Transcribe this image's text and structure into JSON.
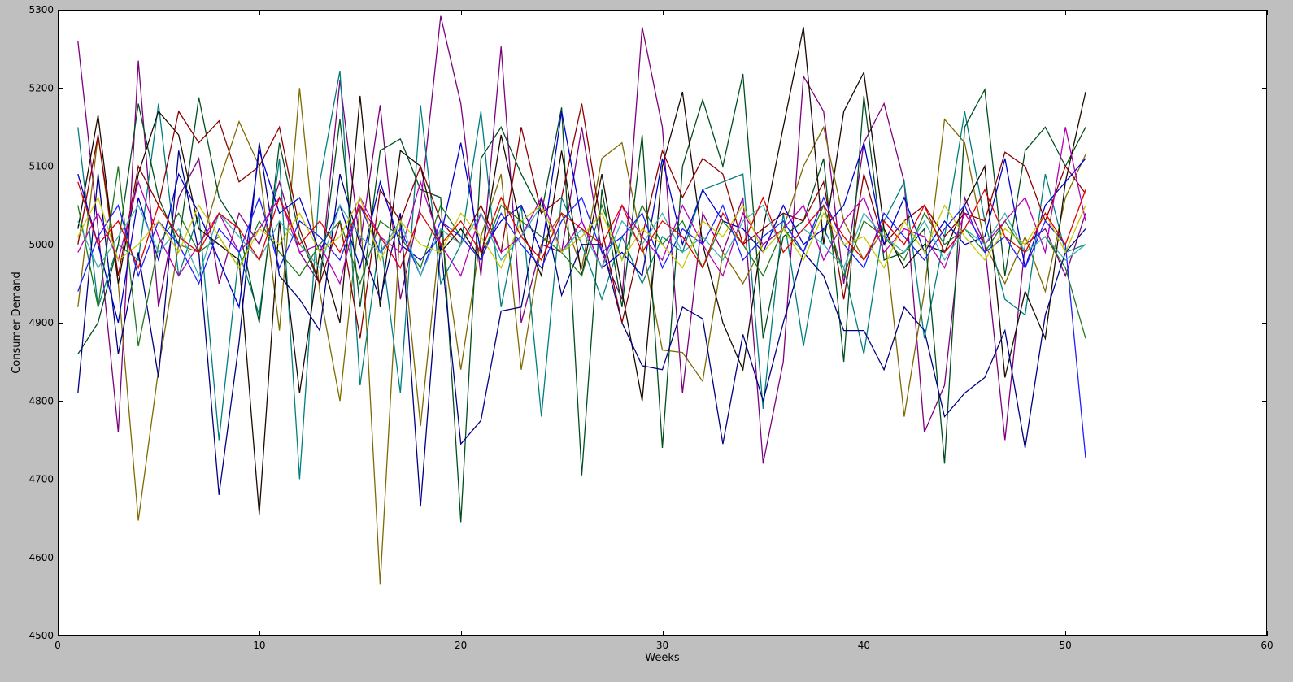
{
  "colors": {
    "background": "#bfbfbf",
    "plot_area": "#ffffff",
    "axes": "#000000"
  },
  "chart_data": {
    "type": "line",
    "title": "",
    "xlabel": "Weeks",
    "ylabel": "Consumer Demand",
    "xlim": [
      0,
      60
    ],
    "ylim": [
      4500,
      5300
    ],
    "xticks": [
      0,
      10,
      20,
      30,
      40,
      50,
      60
    ],
    "yticks": [
      4500,
      4600,
      4700,
      4800,
      4900,
      5000,
      5100,
      5200,
      5300
    ],
    "grid": false,
    "legend": "none",
    "x": [
      1,
      2,
      3,
      4,
      5,
      6,
      7,
      8,
      9,
      10,
      11,
      12,
      13,
      14,
      15,
      16,
      17,
      18,
      19,
      20,
      21,
      22,
      23,
      24,
      25,
      26,
      27,
      28,
      29,
      30,
      31,
      32,
      33,
      34,
      35,
      36,
      37,
      38,
      39,
      40,
      41,
      42,
      43,
      44,
      45,
      46,
      47,
      48,
      49,
      50,
      51
    ],
    "series": [
      {
        "color": "#7f007f",
        "values": [
          5260,
          5020,
          4760,
          5235,
          4920,
          5060,
          5110,
          4950,
          5040,
          5000,
          5080,
          4990,
          4950,
          5210,
          5000,
          5178,
          4930,
          5050,
          5292,
          5180,
          4960,
          5253,
          4900,
          5000,
          4990,
          5150,
          4990,
          4930,
          5278,
          5150,
          4810,
          5040,
          4990,
          5060,
          4720,
          4850,
          5215,
          5170,
          4950,
          5130,
          5180,
          5080,
          4760,
          4820,
          5060,
          5000,
          4750,
          5000,
          5020,
          4960,
          5040
        ]
      },
      {
        "color": "#7f6a00",
        "values": [
          4920,
          5140,
          4950,
          4647,
          4840,
          5000,
          4990,
          5080,
          5157,
          5100,
          4890,
          5200,
          4940,
          4800,
          5050,
          4565,
          5030,
          4768,
          5020,
          4840,
          5010,
          5090,
          4840,
          5000,
          5040,
          4970,
          5110,
          5130,
          5000,
          4865,
          4862,
          4825,
          4990,
          4950,
          5000,
          5020,
          5100,
          5150,
          5030,
          4980,
          5020,
          4780,
          4940,
          5160,
          5130,
          5000,
          4950,
          5010,
          4940,
          5060,
          5115
        ]
      },
      {
        "color": "#007f7f",
        "values": [
          5150,
          4920,
          5000,
          4980,
          5180,
          4960,
          5040,
          4750,
          4990,
          4910,
          5110,
          4700,
          5080,
          5222,
          4820,
          5010,
          4810,
          5178,
          4950,
          5000,
          5170,
          4920,
          5050,
          4780,
          5060,
          5000,
          4930,
          5010,
          4950,
          5010,
          4990,
          5070,
          5080,
          5090,
          4790,
          5040,
          4870,
          5020,
          4970,
          4860,
          5030,
          5080,
          4880,
          5010,
          5170,
          5030,
          4930,
          4910,
          5090,
          4990,
          5000
        ]
      },
      {
        "color": "#004f1f",
        "values": [
          4860,
          4900,
          5000,
          5180,
          5060,
          5000,
          5188,
          5060,
          5020,
          4900,
          5130,
          5010,
          4950,
          5160,
          4920,
          5120,
          5135,
          5070,
          5060,
          4645,
          5110,
          5150,
          5090,
          5040,
          5175,
          4705,
          5070,
          4920,
          5140,
          4740,
          5100,
          5185,
          5100,
          5218,
          4880,
          5010,
          5030,
          5110,
          4850,
          5190,
          4980,
          4990,
          5020,
          4720,
          5150,
          5198,
          4960,
          5120,
          5150,
          5100,
          5150
        ]
      },
      {
        "color": "#1a0a00",
        "values": [
          5020,
          5165,
          4950,
          5090,
          5170,
          5140,
          5020,
          5000,
          4980,
          4655,
          5030,
          4810,
          4990,
          4900,
          5190,
          4920,
          5120,
          5100,
          4990,
          5020,
          4980,
          5140,
          5020,
          4960,
          5120,
          4960,
          5090,
          4940,
          4800,
          5100,
          5195,
          5000,
          4900,
          4840,
          5020,
          5150,
          5278,
          5000,
          5170,
          5220,
          5020,
          4970,
          5000,
          4990,
          5050,
          5100,
          4830,
          4940,
          4880,
          5080,
          5195
        ]
      },
      {
        "color": "#000080",
        "values": [
          4810,
          5090,
          4860,
          4990,
          4830,
          5120,
          4990,
          4680,
          4875,
          5130,
          4960,
          4930,
          4890,
          5090,
          5000,
          4930,
          5040,
          4665,
          5000,
          4745,
          4775,
          4915,
          4920,
          5060,
          4935,
          5000,
          5000,
          4900,
          4845,
          4840,
          4920,
          4905,
          4745,
          4885,
          4800,
          4900,
          4990,
          4960,
          4890,
          4890,
          4840,
          4920,
          4890,
          4780,
          4810,
          4830,
          4890,
          4740,
          4910,
          4990,
          5020
        ]
      },
      {
        "color": "#8b0000",
        "values": [
          5000,
          5140,
          4960,
          5100,
          5050,
          5170,
          5130,
          5158,
          5080,
          5100,
          5150,
          5020,
          4950,
          5030,
          4880,
          5070,
          5030,
          5100,
          5030,
          5000,
          5050,
          4990,
          5150,
          5040,
          5060,
          5180,
          5020,
          4900,
          5010,
          5120,
          5060,
          5110,
          5090,
          5000,
          5020,
          5040,
          5030,
          5080,
          4930,
          5090,
          5000,
          5030,
          5050,
          5010,
          5040,
          5030,
          5118,
          5100,
          5030,
          5100,
          5065
        ]
      },
      {
        "color": "#0000cc",
        "values": [
          5090,
          5000,
          4900,
          5060,
          4980,
          5090,
          5040,
          4980,
          4920,
          5120,
          5040,
          5060,
          4990,
          5050,
          4970,
          5080,
          5000,
          4980,
          5010,
          5130,
          4990,
          5030,
          5050,
          4990,
          5170,
          5030,
          4970,
          4990,
          4960,
          5110,
          5000,
          5070,
          5030,
          5020,
          4990,
          5050,
          5000,
          5020,
          5050,
          5130,
          5000,
          5060,
          4990,
          5030,
          5000,
          5010,
          5110,
          4970,
          5050,
          5080,
          5110
        ]
      },
      {
        "color": "#1e7a1e",
        "values": [
          5050,
          4920,
          5100,
          4870,
          5000,
          5040,
          4990,
          5010,
          4970,
          5030,
          4990,
          4960,
          5000,
          5030,
          4950,
          5030,
          5010,
          4970,
          5050,
          5010,
          4980,
          5050,
          5030,
          5010,
          4990,
          4960,
          5050,
          4980,
          5050,
          5000,
          5030,
          4970,
          5030,
          5000,
          4960,
          5020,
          4990,
          5050,
          4960,
          5030,
          5010,
          4980,
          5040,
          5000,
          5020,
          4990,
          5030,
          4990,
          5010,
          4970,
          4880
        ]
      },
      {
        "color": "#b400b4",
        "values": [
          4990,
          5040,
          4980,
          5080,
          5010,
          4960,
          5000,
          5040,
          4990,
          5020,
          5060,
          4990,
          5000,
          4950,
          5060,
          5010,
          4990,
          5080,
          5000,
          4960,
          5040,
          4990,
          5010,
          5060,
          4990,
          5030,
          4970,
          5050,
          5010,
          4980,
          5050,
          5000,
          4960,
          5040,
          5000,
          5020,
          5050,
          4980,
          5030,
          5060,
          4990,
          5020,
          5010,
          4970,
          5040,
          5000,
          5030,
          5060,
          4990,
          5150,
          5030
        ]
      },
      {
        "color": "#2020ff",
        "values": [
          4940,
          5010,
          5050,
          4960,
          5030,
          5000,
          4950,
          5020,
          4990,
          5060,
          4970,
          5030,
          5010,
          4980,
          5050,
          4990,
          5020,
          4960,
          5030,
          5010,
          4980,
          5040,
          5000,
          4970,
          5030,
          5060,
          4990,
          5010,
          5040,
          4970,
          5020,
          5000,
          5050,
          4980,
          5010,
          5030,
          4990,
          5060,
          5000,
          4970,
          5040,
          5010,
          4980,
          5020,
          5050,
          4990,
          5010,
          4970,
          5030,
          5000,
          4727
        ]
      },
      {
        "color": "#40b0b0",
        "values": [
          5030,
          4970,
          5010,
          5050,
          4990,
          5020,
          4960,
          5040,
          5010,
          4980,
          5030,
          5000,
          4970,
          5050,
          5010,
          4990,
          5030,
          4960,
          5020,
          5000,
          5040,
          4980,
          5010,
          5050,
          4990,
          5020,
          4970,
          5030,
          5000,
          5040,
          4990,
          5010,
          4980,
          5030,
          5050,
          4990,
          5020,
          5000,
          4970,
          5040,
          5010,
          4990,
          5030,
          4980,
          5020,
          5000,
          5040,
          4990,
          5010,
          4980,
          5000
        ]
      },
      {
        "color": "#c8c800",
        "values": [
          5010,
          5060,
          4980,
          5000,
          5030,
          4990,
          5050,
          5010,
          4970,
          5020,
          5000,
          5040,
          4990,
          5010,
          5060,
          4980,
          5030,
          5000,
          4990,
          5040,
          5010,
          4970,
          5030,
          5050,
          4990,
          5010,
          5040,
          4980,
          5020,
          5000,
          4970,
          5030,
          5010,
          5050,
          4990,
          5020,
          4980,
          5040,
          5000,
          5010,
          4970,
          5030,
          4990,
          5050,
          5010,
          4980,
          5020,
          5000,
          5040,
          4990,
          5050
        ]
      },
      {
        "color": "#e00000",
        "values": [
          5080,
          5000,
          5030,
          4970,
          5050,
          5010,
          4990,
          5040,
          5020,
          4980,
          5060,
          5000,
          5030,
          4990,
          5050,
          5010,
          4970,
          5040,
          5000,
          5030,
          4990,
          5060,
          5010,
          4980,
          5040,
          5020,
          5000,
          5050,
          4990,
          5030,
          5010,
          4970,
          5040,
          5000,
          5060,
          4990,
          5020,
          5050,
          5010,
          4980,
          5030,
          5000,
          5050,
          4990,
          5020,
          5070,
          5010,
          4990,
          5040,
          5000,
          5070
        ]
      }
    ]
  }
}
